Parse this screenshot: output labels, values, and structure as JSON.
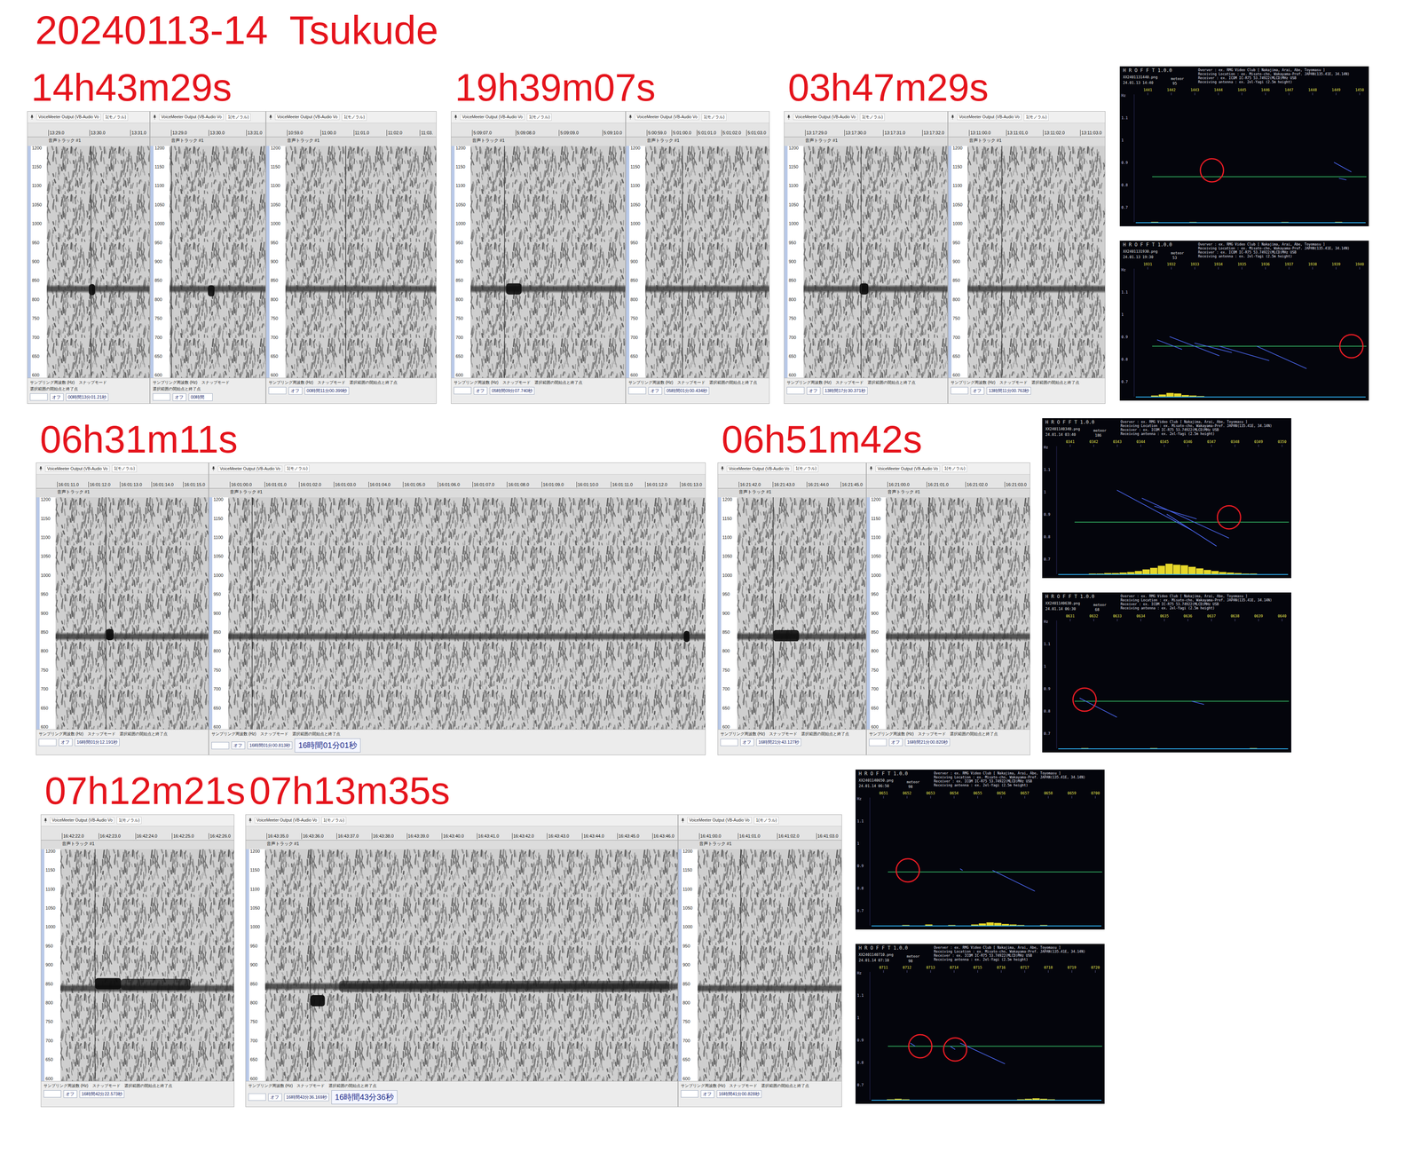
{
  "title": "20240113-14  Tsukude",
  "toolbar": {
    "device": "VoiceMeeter Output (VB-Audio Vo",
    "channel": "1(モノラル)"
  },
  "track_label": "音声トラック #1",
  "spectrogram_axis": [
    "1200",
    "1150",
    "1100",
    "1050",
    "1000",
    "950",
    "900",
    "850",
    "800",
    "750",
    "700",
    "650",
    "600"
  ],
  "status_labels": [
    "サンプリング周波数 (Hz)",
    "スナップモード",
    "選択範囲の開始点と終了点"
  ],
  "snap_value": "オフ",
  "hrofft_header": {
    "logo": "H R O F F T  1.0.0",
    "kind": "meteor",
    "lines": [
      "Overver : ex. RMG Video Club [ Nakajima, Arai, Abe, Toyomasu ]",
      "Receiving Location : ex. Misato-cho, Wakayama-Pref. JAPAN(135.41E, 34.14N)",
      "Receiver : ex. ICOM IC-R75 53.74922(MLCD)MHz USB",
      "Receiving antenna : ex. 2el-Yagi (2.5m height)"
    ],
    "axis": [
      "Hz",
      "1.1",
      "1",
      "0.9",
      "0.8",
      "0.7"
    ]
  },
  "rows": [
    {
      "groups": [
        {
          "caption": "14h43m29s",
          "panels": [
            {
              "ticks": [
                "13:29.0",
                "13:30.0",
                "13:31.0"
              ],
              "time": "00時間13分01.21秒",
              "cursor": 0.43,
              "carrier_hz": 830,
              "pings": [
                {
                  "t": 0.41,
                  "hz": 828,
                  "dur": 0.06,
                  "level": 0.95
                }
              ]
            },
            {
              "ticks": [
                "13:29.0",
                "13:30.0",
                "13:31.0"
              ],
              "time": "00時間",
              "cursor": 0.02,
              "carrier_hz": 830,
              "pings": [
                {
                  "t": 0.4,
                  "hz": 825,
                  "dur": 0.07,
                  "level": 0.9
                }
              ]
            },
            {
              "ticks": [
                "10:59.0",
                "11:00.0",
                "11:01.0",
                "11:02.0",
                "11:03."
              ],
              "time": "00時間11分00.399秒",
              "cursor": 0.4,
              "carrier_hz": 830,
              "pings": []
            }
          ]
        },
        {
          "caption": "19h39m07s",
          "panels": [
            {
              "ticks": [
                "5:09:07.0",
                "5:09:08.0",
                "5:09:09.0",
                "5:09:10.0"
              ],
              "time": "05時間09分07.740秒",
              "cursor": 0.22,
              "carrier_hz": 830,
              "pings": [
                {
                  "t": 0.23,
                  "hz": 830,
                  "dur": 0.1,
                  "level": 0.9
                }
              ]
            },
            {
              "ticks": [
                "5:00:59.0",
                "5:01:00.0",
                "5:01:01.0",
                "5:01:02.0",
                "5:01:03.0"
              ],
              "time": "05時間01分00.434秒",
              "cursor": 0.3,
              "carrier_hz": 830,
              "pings": []
            }
          ]
        },
        {
          "caption": "03h47m29s",
          "panels": [
            {
              "ticks": [
                "13:17:29.0",
                "13:17:30.0",
                "13:17:31.0",
                "13:17:32.0"
              ],
              "time": "13時間17分30.371秒",
              "cursor": 0.4,
              "carrier_hz": 830,
              "pings": [
                {
                  "t": 0.39,
                  "hz": 830,
                  "dur": 0.06,
                  "level": 0.95
                }
              ]
            },
            {
              "ticks": [
                "13:11:00.0",
                "13:11:01.0",
                "13:11:02.0",
                "13:11:03.0"
              ],
              "time": "13時間11分00.763秒",
              "cursor": 0.25,
              "carrier_hz": 830,
              "pings": []
            }
          ]
        }
      ],
      "hrofft": [
        {
          "file": "XX2401131440.png",
          "date": "24.01.13 14:40",
          "count": "95",
          "ticks": [
            "1441",
            "1442",
            "1443",
            "1444",
            "1445",
            "1446",
            "1447",
            "1448",
            "1449",
            "1450"
          ],
          "line": [
            0.13,
            0.69
          ],
          "circles": [
            [
              0.37,
              0.65
            ]
          ],
          "streaks": [
            [
              0.86,
              0.6,
              0.93,
              0.66
            ],
            [
              0.88,
              0.7,
              0.91,
              0.71
            ]
          ],
          "histogram": [
            0,
            0,
            0.04,
            0,
            0,
            0,
            0,
            0.03,
            0,
            0,
            0,
            0,
            0,
            0,
            0,
            0,
            0,
            0,
            0,
            0.03,
            0,
            0,
            0,
            0,
            0,
            0,
            0.04,
            0,
            0,
            0
          ]
        },
        {
          "file": "XX2401131930.png",
          "date": "24.01.13 19:30",
          "count": "53",
          "ticks": [
            "1931",
            "1932",
            "1933",
            "1934",
            "1935",
            "1936",
            "1937",
            "1938",
            "1939",
            "1940"
          ],
          "line": [
            0.13,
            0.66
          ],
          "circles": [
            [
              0.93,
              0.66
            ]
          ],
          "streaks": [
            [
              0.15,
              0.62,
              0.25,
              0.68
            ],
            [
              0.2,
              0.6,
              0.4,
              0.72
            ],
            [
              0.3,
              0.64,
              0.45,
              0.7
            ],
            [
              0.4,
              0.66,
              0.6,
              0.75
            ],
            [
              0.55,
              0.66,
              0.75,
              0.8
            ]
          ],
          "histogram": [
            0,
            0,
            0.1,
            0.2,
            0.35,
            0.3,
            0.15,
            0.1,
            0.05,
            0,
            0,
            0,
            0,
            0,
            0,
            0,
            0,
            0,
            0,
            0,
            0,
            0,
            0,
            0,
            0,
            0,
            0,
            0,
            0,
            0
          ]
        }
      ]
    },
    {
      "groups": [
        {
          "caption": "06h31m11s",
          "panels": [
            {
              "ticks": [
                "16:01:11.0",
                "16:01:12.0",
                "16:01:13.0",
                "16:01:14.0",
                "16:01:15.0"
              ],
              "time": "16時間01分12.191秒",
              "cursor": 0.33,
              "carrier_hz": 840,
              "pings": [
                {
                  "t": 0.33,
                  "hz": 845,
                  "dur": 0.05,
                  "level": 0.95
                }
              ]
            },
            {
              "ticks": [
                "16:01:00.0",
                "16:01:01.0",
                "16:01:02.0",
                "16:01:03.0",
                "16:01:04.0",
                "16:01:05.0",
                "16:01:06.0",
                "16:01:07.0",
                "16:01:08.0",
                "16:01:09.0",
                "16:01:10.0",
                "16:01:11.0",
                "16:01:12.0",
                "16:01:13.0"
              ],
              "time": "16時間01分00.813秒",
              "big_time": "16時間01分01秒",
              "cursor": 0.05,
              "carrier_hz": 840,
              "pings": [
                {
                  "t": 0.955,
                  "hz": 840,
                  "dur": 0.012,
                  "level": 0.95
                }
              ]
            }
          ]
        },
        {
          "caption": "06h51m42s",
          "panels": [
            {
              "ticks": [
                "16:21:42.0",
                "16:21:43.0",
                "16:21:44.0",
                "16:21:45.0"
              ],
              "time": "16時間21分43.127秒",
              "cursor": 0.28,
              "carrier_hz": 840,
              "pings": [
                {
                  "t": 0.28,
                  "hz": 842,
                  "dur": 0.2,
                  "level": 0.9
                }
              ]
            },
            {
              "ticks": [
                "16:21:00.0",
                "16:21:01.0",
                "16:21:02.0",
                "16:21:03.0"
              ],
              "time": "16時間21分00.820秒",
              "cursor": 0.3,
              "carrier_hz": 840,
              "pings": []
            }
          ]
        }
      ],
      "hrofft": [
        {
          "file": "XX2401140340.png",
          "date": "24.01.14 03:40",
          "count": "186",
          "ticks": [
            "0341",
            "0342",
            "0343",
            "0344",
            "0345",
            "0346",
            "0347",
            "0348",
            "0349",
            "0350"
          ],
          "line": [
            0.13,
            0.65
          ],
          "circles": [
            [
              0.75,
              0.62
            ]
          ],
          "streaks": [
            [
              0.3,
              0.45,
              0.6,
              0.7
            ],
            [
              0.4,
              0.5,
              0.75,
              0.75
            ],
            [
              0.5,
              0.6,
              0.7,
              0.8
            ],
            [
              0.45,
              0.55,
              0.62,
              0.63
            ]
          ],
          "histogram": [
            0,
            0,
            0,
            0,
            0.05,
            0.05,
            0.1,
            0.1,
            0.15,
            0.2,
            0.3,
            0.45,
            0.6,
            0.8,
            1,
            0.9,
            0.85,
            0.7,
            0.55,
            0.4,
            0.3,
            0.2,
            0.15,
            0.1,
            0.05,
            0.05,
            0,
            0,
            0,
            0
          ]
        },
        {
          "file": "XX2401140630.png",
          "date": "24.01.14 06:30",
          "count": "68",
          "ticks": [
            "0631",
            "0632",
            "0633",
            "0634",
            "0635",
            "0636",
            "0637",
            "0638",
            "0639",
            "0640"
          ],
          "line": [
            0.13,
            0.68
          ],
          "circles": [
            [
              0.17,
              0.67
            ]
          ],
          "streaks": [
            [
              0.15,
              0.66,
              0.3,
              0.78
            ],
            [
              0.6,
              0.68,
              0.65,
              0.7
            ]
          ],
          "histogram": [
            0,
            0,
            0,
            0.03,
            0,
            0,
            0,
            0,
            0,
            0,
            0,
            0,
            0.03,
            0,
            0,
            0,
            0,
            0,
            0,
            0,
            0,
            0,
            0,
            0,
            0,
            0.03,
            0,
            0,
            0,
            0
          ]
        }
      ]
    },
    {
      "groups": [
        {
          "caption": "07h12m21s",
          "panels": [
            {
              "ticks": [
                "16:42:22.0",
                "16:42:23.0",
                "16:42:24.0",
                "16:42:25.0",
                "16:42:26.0"
              ],
              "time": "16時間42分22.573秒",
              "cursor": 0.2,
              "carrier_hz": 840,
              "pings": [
                {
                  "t": 0.2,
                  "hz": 852,
                  "dur": 0.15,
                  "level": 0.95
                },
                {
                  "t": 0.35,
                  "hz": 850,
                  "dur": 0.4,
                  "level": 0.7
                }
              ]
            }
          ]
        },
        {
          "caption": "07h13m35s",
          "panels": [
            {
              "ticks": [
                "16:43:35.0",
                "16:43:36.0",
                "16:43:37.0",
                "16:43:38.0",
                "16:43:39.0",
                "16:43:40.0",
                "16:43:41.0",
                "16:43:42.0",
                "16:43:43.0",
                "16:43:44.0",
                "16:43:45.0",
                "16:43:46.0"
              ],
              "time": "16時間43分36.169秒",
              "big_time": "16時間43分36秒",
              "cursor": 0.11,
              "carrier_hz": 845,
              "pings": [
                {
                  "t": 0.11,
                  "hz": 808,
                  "dur": 0.035,
                  "level": 0.95
                },
                {
                  "t": 0.18,
                  "hz": 845,
                  "dur": 0.8,
                  "level": 0.55
                }
              ]
            },
            {
              "ticks": [
                "16:41:00.0",
                "16:41:01.0",
                "16:41:02.0",
                "16:41:03.0"
              ],
              "time": "16時間41分00.828秒",
              "cursor": 0.3,
              "carrier_hz": 840,
              "pings": []
            }
          ]
        }
      ],
      "hrofft": [
        {
          "file": "XX2401140650.png",
          "date": "24.01.14 06:50",
          "count": "98",
          "ticks": [
            "0651",
            "0652",
            "0653",
            "0654",
            "0655",
            "0656",
            "0657",
            "0658",
            "0659",
            "0700"
          ],
          "line": [
            0.13,
            0.64
          ],
          "circles": [
            [
              0.21,
              0.63
            ]
          ],
          "streaks": [
            [
              0.55,
              0.63,
              0.72,
              0.76
            ],
            [
              0.42,
              0.62,
              0.43,
              0.63
            ]
          ],
          "histogram": [
            0,
            0,
            0,
            0,
            0.05,
            0,
            0,
            0.1,
            0,
            0,
            0.05,
            0,
            0,
            0.1,
            0.2,
            0.3,
            0.25,
            0.15,
            0.1,
            0.05,
            0,
            0,
            0.05,
            0,
            0,
            0,
            0,
            0,
            0,
            0
          ]
        },
        {
          "file": "XX2401140710.png",
          "date": "24.01.14 07:10",
          "count": "98",
          "ticks": [
            "0711",
            "0712",
            "0713",
            "0714",
            "0715",
            "0716",
            "0717",
            "0718",
            "0719",
            "0720"
          ],
          "line": [
            0.13,
            0.64
          ],
          "circles": [
            [
              0.26,
              0.64
            ],
            [
              0.4,
              0.66
            ]
          ],
          "streaks": [
            [
              0.42,
              0.62,
              0.6,
              0.75
            ],
            [
              0.22,
              0.62,
              0.24,
              0.64
            ],
            [
              0.38,
              0.64,
              0.4,
              0.66
            ]
          ],
          "histogram": [
            0,
            0,
            0.05,
            0.1,
            0.05,
            0,
            0,
            0,
            0,
            0,
            0,
            0,
            0,
            0,
            0,
            0,
            0,
            0,
            0,
            0.05,
            0.1,
            0.15,
            0.1,
            0.05,
            0,
            0,
            0,
            0,
            0,
            0
          ]
        }
      ]
    }
  ]
}
